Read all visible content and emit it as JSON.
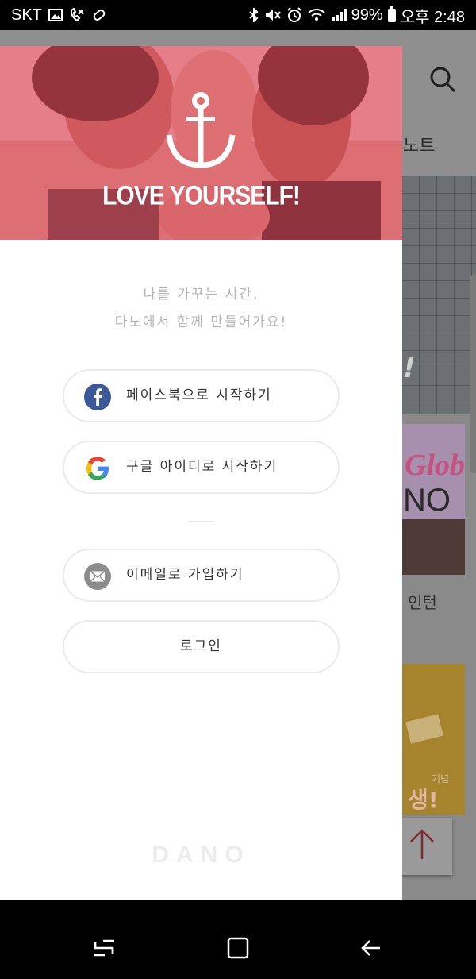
{
  "status_bar": {
    "carrier": "SKT",
    "battery": "99%",
    "time": "오후 2:48",
    "icons": [
      "image-icon",
      "missed-call-icon",
      "pill-icon",
      "bluetooth-icon",
      "mute-icon",
      "alarm-icon",
      "wifi-icon",
      "signal-icon",
      "battery-icon"
    ]
  },
  "background_app": {
    "tab_text": "노트",
    "card_headline": "!",
    "card2_title": "Globa",
    "card2_sub": "NO",
    "card2_caption": "인턴",
    "card3_small": "기념",
    "card3_big": "생!"
  },
  "drawer": {
    "hero": {
      "tagline": "LOVE YOURSELF!"
    },
    "intro": {
      "line1": "나를 가꾸는 시간,",
      "line2": "다노에서 함께 만들어가요!"
    },
    "buttons": {
      "facebook": "페이스북으로 시작하기",
      "google": "구글 아이디로 시작하기",
      "email": "이메일로 가입하기",
      "login": "로그인"
    },
    "brand": "DANO"
  },
  "colors": {
    "hero_tint": "#e2465a",
    "facebook_blue": "#3b5998",
    "mail_gray": "#8c8c8c",
    "intro_text": "#b7b7b7"
  }
}
